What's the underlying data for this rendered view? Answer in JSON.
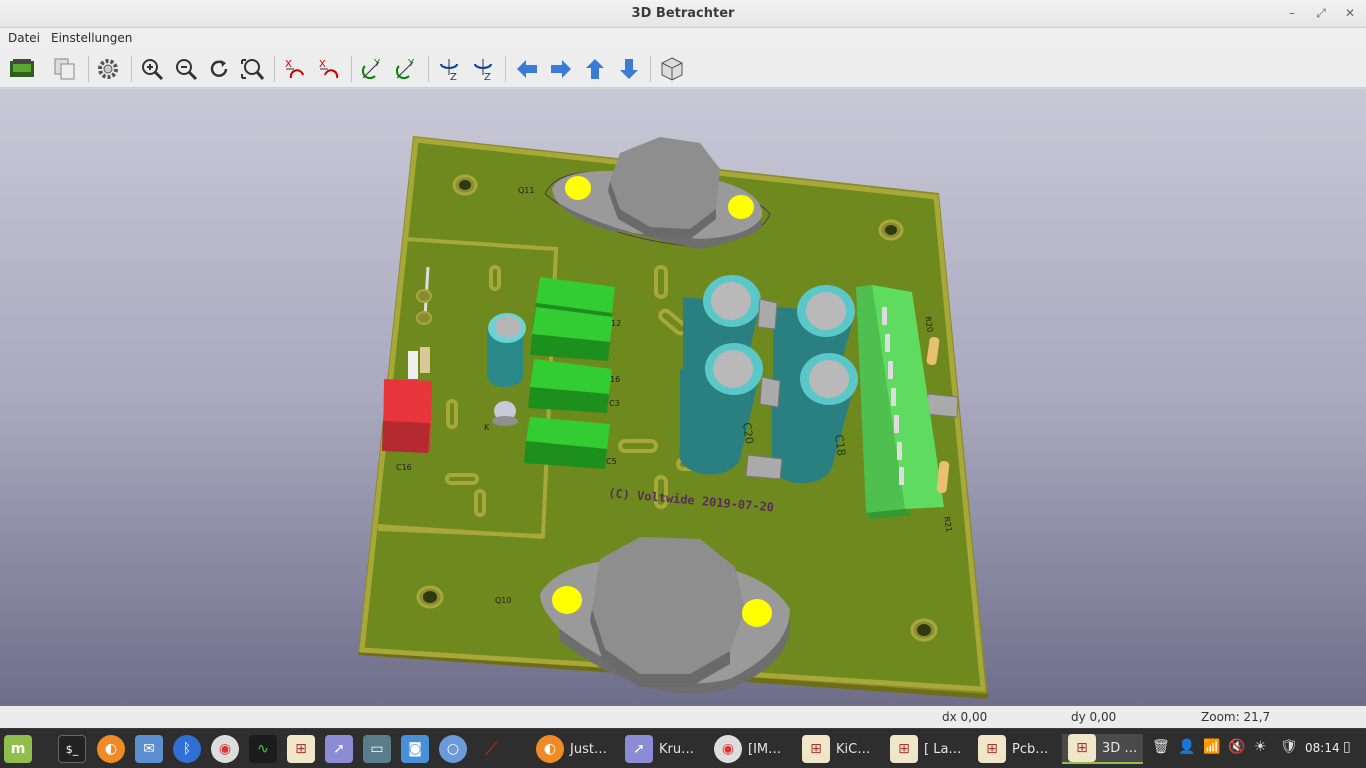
{
  "window": {
    "title": "3D Betrachter"
  },
  "menu": {
    "items": [
      "Datei",
      "Einstellungen"
    ]
  },
  "toolbar": {
    "buttons": [
      "export-icon",
      "copy-icon",
      "settings-icon",
      "zoom-in-icon",
      "zoom-out-icon",
      "redraw-icon",
      "zoom-fit-icon",
      "rotate-x-cw-icon",
      "rotate-x-ccw-icon",
      "rotate-y-cw-icon",
      "rotate-y-ccw-icon",
      "rotate-z-cw-icon",
      "rotate-z-ccw-icon",
      "move-left-icon",
      "move-right-icon",
      "move-up-icon",
      "move-down-icon",
      "ortho-icon"
    ]
  },
  "board": {
    "silkscreen": "(C) Voltwide 2019-07-20",
    "refs": {
      "q11": "Q11",
      "q10": "Q10",
      "c16": "C16",
      "c20": "C20",
      "c18": "C18",
      "c3": "C3",
      "c5": "C5",
      "c2": "12",
      "c6": "16",
      "r21": "R21",
      "r20": "R20",
      "k": "K"
    }
  },
  "status": {
    "dx": "dx 0,00",
    "dy": "dy 0,00",
    "zoom": "Zoom: 21,7"
  },
  "taskbar": {
    "windows": [
      {
        "label": "Just…",
        "icon": "firefox-icon"
      },
      {
        "label": "Kru…",
        "icon": "screenshot-tool-icon"
      },
      {
        "label": "[IM…",
        "icon": "chrome-icon"
      },
      {
        "label": "KiC…",
        "icon": "kicad-icon"
      },
      {
        "label": "[ La…",
        "icon": "kicad-icon"
      },
      {
        "label": "Pcb…",
        "icon": "kicad-icon"
      },
      {
        "label": "3D …",
        "icon": "kicad-icon"
      }
    ],
    "clock": "08:14"
  },
  "colors": {
    "pcb": "#6e8a1e",
    "pcb_edge": "#9b9b2e",
    "pad": "#ffff00",
    "viewport_top": "#c8c8d6",
    "viewport_bottom": "#6e6e8a"
  }
}
